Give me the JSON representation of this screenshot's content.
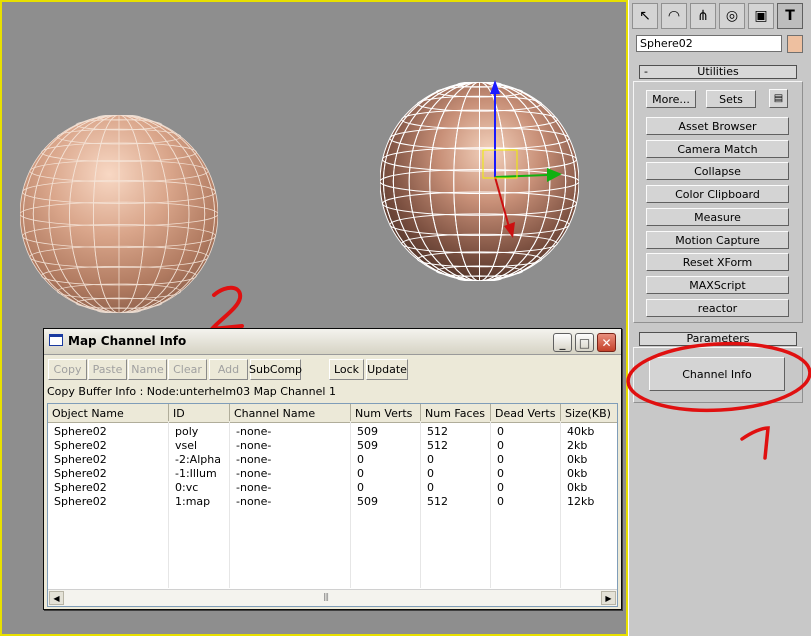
{
  "viewport": {
    "annotations": {
      "label_2": "2",
      "label_1": "1"
    }
  },
  "command_panel": {
    "tabs": [
      {
        "name": "create-tab-icon",
        "glyph": "↖"
      },
      {
        "name": "modify-tab-icon",
        "glyph": "◠"
      },
      {
        "name": "hierarchy-tab-icon",
        "glyph": "⋔"
      },
      {
        "name": "motion-tab-icon",
        "glyph": "◎"
      },
      {
        "name": "display-tab-icon",
        "glyph": "▣"
      },
      {
        "name": "utilities-tab-icon",
        "glyph": "T"
      }
    ],
    "object_name": "Sphere02",
    "object_color": "#eec0a0",
    "utilities": {
      "header": "Utilities",
      "collapse_glyph": "-",
      "more_label": "More...",
      "sets_label": "Sets",
      "buttons": [
        "Asset Browser",
        "Camera Match",
        "Collapse",
        "Color Clipboard",
        "Measure",
        "Motion Capture",
        "Reset XForm",
        "MAXScript",
        "reactor"
      ]
    },
    "parameters": {
      "header": "Parameters",
      "channel_info_label": "Channel Info"
    }
  },
  "dialog": {
    "title": "Map Channel Info",
    "toolbar": {
      "copy": "Copy",
      "paste": "Paste",
      "name": "Name",
      "clear": "Clear",
      "add": "Add",
      "subcomp": "SubComp",
      "lock": "Lock",
      "update": "Update"
    },
    "buffer_info": "Copy Buffer Info : Node:unterhelm03 Map Channel 1",
    "columns": [
      "Object Name",
      "ID",
      "Channel Name",
      "Num Verts",
      "Num Faces",
      "Dead Verts",
      "Size(KB)"
    ],
    "rows": [
      [
        "Sphere02",
        "poly",
        "-none-",
        "509",
        "512",
        "0",
        "40kb"
      ],
      [
        "Sphere02",
        "vsel",
        "-none-",
        "509",
        "512",
        "0",
        "2kb"
      ],
      [
        "Sphere02",
        "-2:Alpha",
        "-none-",
        "0",
        "0",
        "0",
        "0kb"
      ],
      [
        "Sphere02",
        "-1:Illum",
        "-none-",
        "0",
        "0",
        "0",
        "0kb"
      ],
      [
        "Sphere02",
        "0:vc",
        "-none-",
        "0",
        "0",
        "0",
        "0kb"
      ],
      [
        "Sphere02",
        "1:map",
        "-none-",
        "509",
        "512",
        "0",
        "12kb"
      ]
    ],
    "scroll_grip": "|||"
  },
  "colors": {
    "viewport_bg": "#8e8e8e",
    "active_viewport_border": "#e8e000",
    "annotation": "#e01010"
  }
}
